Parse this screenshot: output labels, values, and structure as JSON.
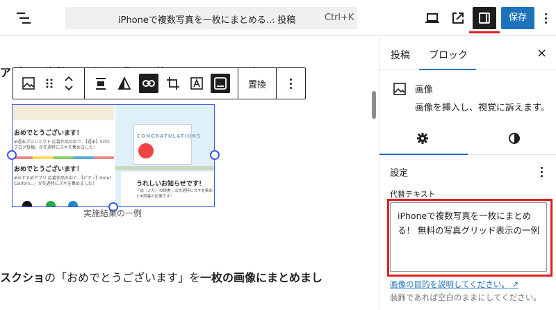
{
  "header": {
    "doc_title": "iPhoneで複数写真を一枚にまとめる…",
    "doc_type": "· 投稿",
    "shortcut": "Ctrl+K",
    "save_label": "保存"
  },
  "canvas": {
    "heading_text": "アプリで複数の写真や画像を一枚にまとめることができます。",
    "toolbar": {
      "replace_label": "置換"
    },
    "image": {
      "left_card1_title": "おめでとうございます！",
      "left_card1_body": "#週末プロジェクト 応募作品の中で、【週末】SITO ブログ投稿」が先週特にスキを集めました！",
      "left_card2_title": "おめでとうございます！",
      "left_card2_body": "#おすすめアプリ 応募作品の中で、【ピアノ】Hotel Californ...」が先週特にスキを集めました！",
      "banner_text": "CONGRATULATIONS",
      "right_card_title": "うれしいお知らせです！",
      "right_card_body": "「自（ぶり）の読書」は先週特にスキを集めた#読書の記事です！"
    },
    "caption": "実施結果の一例",
    "paragraph_prefix": "スクショ",
    "paragraph_middle": "の「おめでとうございます」を",
    "paragraph_bold": "一枚の画像にまとめまし"
  },
  "sidebar": {
    "tab_post": "投稿",
    "tab_block": "ブロック",
    "close_label": "×",
    "block_title": "画像",
    "block_description": "画像を挿入し、視覚に訴えます。",
    "settings_label": "設定",
    "alt_label": "代替テキスト",
    "alt_value": "iPhoneで複数写真を一枚にまとめる！ 無料の写真グリッド表示の一例",
    "alt_link": "画像の目的を説明してください。",
    "alt_help": "装飾であれば空白のままにしてください。"
  },
  "colors": {
    "accent": "#1e72bd",
    "highlight": "#e02020",
    "selection": "#3858e9"
  }
}
